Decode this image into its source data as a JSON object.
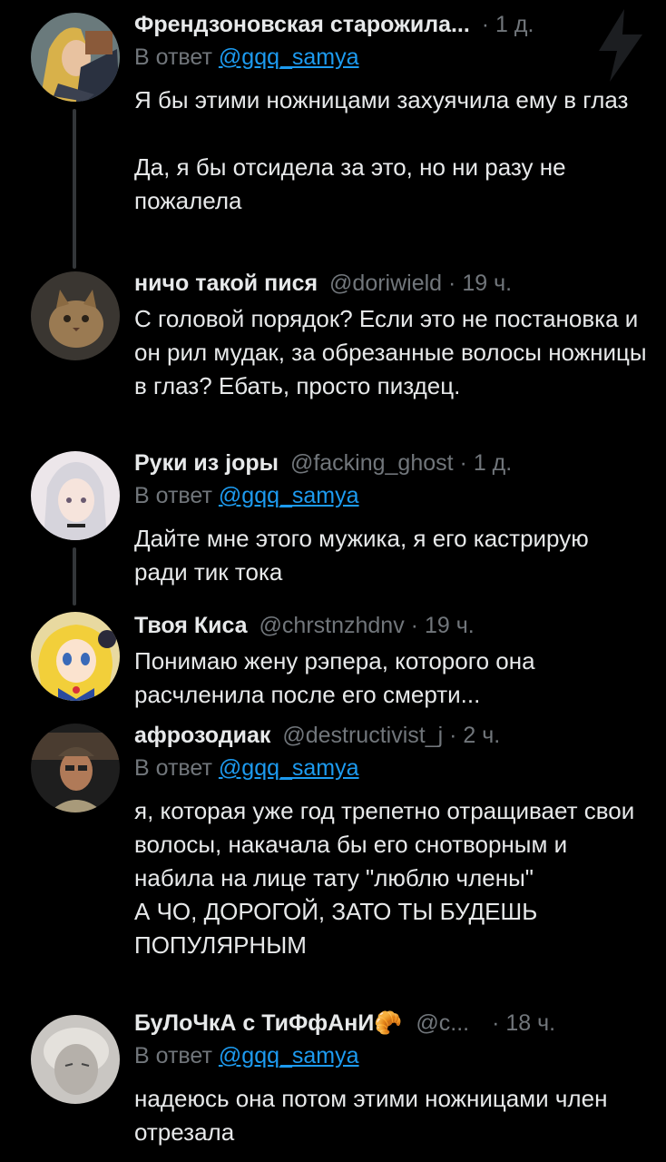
{
  "tweets": [
    {
      "name": "Френдзоновская старожила...",
      "handle": "",
      "time": "1 д.",
      "reply_prefix": "В ответ",
      "reply_to": "@gqq_samya",
      "text_lines": [
        "Я бы этими ножницами захуячила ему в глаз",
        "",
        "Да, я бы отсидела за это, но ни разу не пожалела"
      ],
      "avatar": "avatar-cartoon-blonde"
    },
    {
      "name": "ничо такой пися",
      "handle": "@doriwield",
      "time": "19 ч.",
      "text_lines": [
        "С головой порядок? Если это не постановка и он рил мудак, за обрезанные волосы ножницы в глаз? Ебать, просто пиздец."
      ],
      "avatar": "avatar-cat"
    },
    {
      "name": "Руки из jоры",
      "handle": "@facking_ghost",
      "time": "1 д.",
      "reply_prefix": "В ответ",
      "reply_to": "@gqq_samya",
      "text_lines": [
        "Дайте мне этого мужика, я его кастрирую ради тик тока"
      ],
      "avatar": "avatar-anime-girl"
    },
    {
      "name": "Твоя Киса",
      "handle": "@chrstnzhdnv",
      "time": "19 ч.",
      "text_lines": [
        "Понимаю жену рэпера, которого она расчленила после его смерти..."
      ],
      "avatar": "avatar-sailor-moon"
    },
    {
      "name": "афрозодиак",
      "handle": "@destructivist_j",
      "time": "2 ч.",
      "reply_prefix": "В ответ",
      "reply_to": "@gqq_samya",
      "text_lines": [
        "я, которая уже год трепетно отращивает свои волосы, накачала бы его снотворным и набила на лице тату \"люблю члены\"",
        "А ЧО, ДОРОГОЙ, ЗАТО ТЫ БУДЕШЬ ПОПУЛЯРНЫМ"
      ],
      "avatar": "avatar-man-cap"
    },
    {
      "name": "БуЛоЧкА с ТиФфАнИ🥐",
      "handle": "@c...",
      "time": "18 ч.",
      "reply_prefix": "В ответ",
      "reply_to": "@gqq_samya",
      "text_lines": [
        "надеюсь она потом этими ножницами член отрезала"
      ],
      "avatar": "avatar-blurred-face"
    }
  ],
  "separator": "·"
}
